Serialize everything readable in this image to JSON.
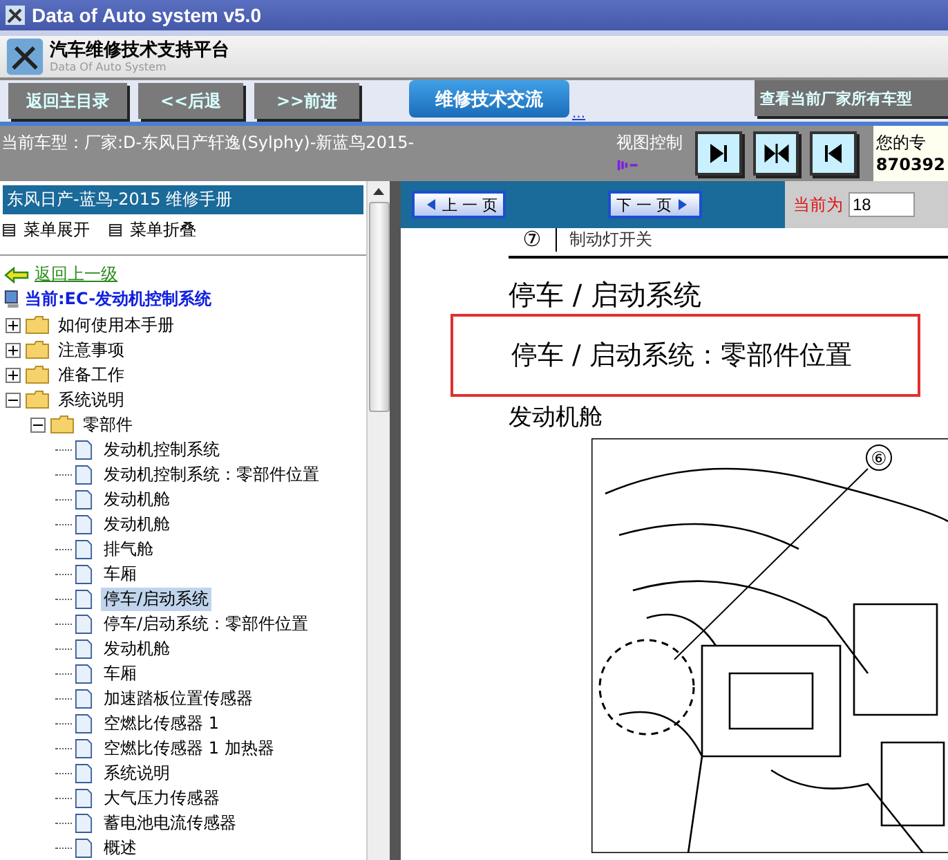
{
  "window": {
    "title": "Data of Auto system v5.0"
  },
  "header": {
    "title": "汽车维修技术支持平台",
    "subtitle": "Data Of Auto System"
  },
  "nav_buttons": [
    "返回主目录",
    "<<后退",
    ">>前进"
  ],
  "exchange_button": {
    "label": "维修技术交流",
    "link": "..."
  },
  "manufacturer_button": "查看当前厂家所有车型",
  "model_bar": {
    "label": "当前车型：厂家:D-东风日产轩逸(Sylphy)-新蓝鸟2015-",
    "view_control": "视图控制",
    "notice": "您的专",
    "number": "870392"
  },
  "sidebar": {
    "title": "东风日产-蓝鸟-2015 维修手册",
    "expand_all": "菜单展开",
    "collapse_all": "菜单折叠",
    "back": "返回上一级",
    "current": "当前:EC-发动机控制系统",
    "tree": [
      {
        "label": "如何使用本手册",
        "kind": "folder",
        "expanded": false,
        "selected": false
      },
      {
        "label": "注意事项",
        "kind": "folder",
        "expanded": false,
        "selected": false
      },
      {
        "label": "准备工作",
        "kind": "folder",
        "expanded": false,
        "selected": false
      },
      {
        "label": "系统说明",
        "kind": "folder",
        "expanded": true,
        "selected": false,
        "children": [
          {
            "label": "零部件",
            "kind": "folder",
            "expanded": true,
            "selected": false,
            "children": [
              {
                "label": "发动机控制系统",
                "kind": "page",
                "selected": false
              },
              {
                "label": "发动机控制系统：零部件位置",
                "kind": "page",
                "selected": false
              },
              {
                "label": "发动机舱",
                "kind": "page",
                "selected": false
              },
              {
                "label": "发动机舱",
                "kind": "page",
                "selected": false
              },
              {
                "label": "排气舱",
                "kind": "page",
                "selected": false
              },
              {
                "label": "车厢",
                "kind": "page",
                "selected": false
              },
              {
                "label": "停车/启动系统",
                "kind": "page",
                "selected": true
              },
              {
                "label": "停车/启动系统：零部件位置",
                "kind": "page",
                "selected": false
              },
              {
                "label": "发动机舱",
                "kind": "page",
                "selected": false
              },
              {
                "label": "车厢",
                "kind": "page",
                "selected": false
              },
              {
                "label": "加速踏板位置传感器",
                "kind": "page",
                "selected": false
              },
              {
                "label": "空燃比传感器 1",
                "kind": "page",
                "selected": false
              },
              {
                "label": "空燃比传感器 1 加热器",
                "kind": "page",
                "selected": false
              },
              {
                "label": "系统说明",
                "kind": "page",
                "selected": false
              },
              {
                "label": "大气压力传感器",
                "kind": "page",
                "selected": false
              },
              {
                "label": "蓄电池电流传感器",
                "kind": "page",
                "selected": false
              },
              {
                "label": "概述",
                "kind": "page",
                "selected": false
              }
            ]
          }
        ]
      }
    ]
  },
  "pager": {
    "prev": "上 一 页",
    "next": "下 一 页",
    "current_label": "当前为",
    "current_page": "18"
  },
  "document": {
    "table_row": {
      "number": "⑦",
      "text": "制动灯开关"
    },
    "heading": "停车 / 启动系统",
    "highlighted_heading": "停车 / 启动系统：零部件位置",
    "section": "发动机舱",
    "callout": "⑥"
  }
}
